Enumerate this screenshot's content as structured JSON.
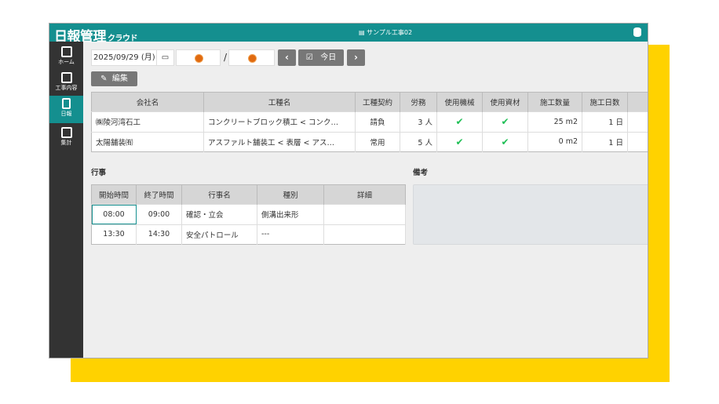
{
  "app": {
    "logo": "日報管理",
    "logo_sub": "クラウド",
    "project": "サンプル工事02"
  },
  "sidebar": {
    "items": [
      {
        "label": "ホーム"
      },
      {
        "label": "工事内容"
      },
      {
        "label": "日報"
      },
      {
        "label": "集計"
      }
    ]
  },
  "toolbar": {
    "date": "2025/09/29 (月)",
    "separator": "/",
    "today": "今日",
    "prev": "‹",
    "next": "›",
    "edit": "編集"
  },
  "work_table": {
    "headers": [
      "会社名",
      "工種名",
      "工種契約",
      "労務",
      "使用機械",
      "使用資材",
      "施工数量",
      "施工日数",
      ""
    ],
    "rows": [
      [
        "㈱陵河湾石工",
        "コンクリートブロック積工 < コンク…",
        "請負",
        "3 人",
        "✔",
        "✔",
        "25 m2",
        "1 日",
        ""
      ],
      [
        "太陽舗装㈲",
        "アスファルト舗装工 < 表層 < アス…",
        "常用",
        "5 人",
        "✔",
        "✔",
        "0 m2",
        "1 日",
        ""
      ]
    ]
  },
  "events": {
    "title": "行事",
    "headers": [
      "開始時間",
      "終了時間",
      "行事名",
      "種別",
      "詳細"
    ],
    "rows": [
      [
        "08:00",
        "09:00",
        "確認・立会",
        "側溝出来形",
        ""
      ],
      [
        "13:30",
        "14:30",
        "安全パトロール",
        "---",
        ""
      ]
    ]
  },
  "remarks": {
    "title": "備考"
  }
}
